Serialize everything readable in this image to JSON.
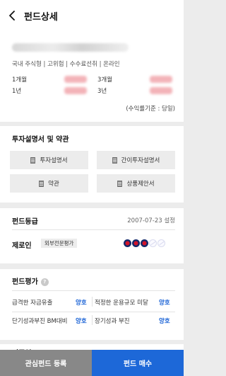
{
  "header": {
    "title": "펀드상세"
  },
  "summary": {
    "tags": "국내 주식형 | 고위험 | 수수료선취 | 온라인",
    "perf": [
      {
        "label": "1개월"
      },
      {
        "label": "3개월"
      },
      {
        "label": "1년"
      },
      {
        "label": "3년"
      }
    ],
    "basis": "(수익률기준 : 당일)"
  },
  "docs": {
    "title": "투자설명서 및 약관",
    "buttons": [
      "투자설명서",
      "간이투자설명서",
      "약관",
      "상품제안서"
    ]
  },
  "grade": {
    "title": "펀드등급",
    "date": "2007-07-23 설정",
    "agency": "제로인",
    "agency_badge": "외부전문평가",
    "level": 3,
    "max": 5
  },
  "evaluation": {
    "title": "펀드평가",
    "help": "?",
    "items": [
      {
        "label": "급격한 자금유출",
        "value": "양호"
      },
      {
        "label": "적정한 운용규모 미달",
        "value": "양호"
      },
      {
        "label": "단기성과부진 BM대비",
        "value": "양호"
      },
      {
        "label": "장기성과 부진",
        "value": "양호"
      }
    ]
  },
  "next_section": {
    "title": "기준일"
  },
  "actions": {
    "watch_label": "관심펀드 등록",
    "buy_label": "펀드 매수"
  },
  "colors": {
    "accent": "#1d68d8",
    "good": "#1b63d6",
    "gray_button": "#888888",
    "bg": "#ececec"
  }
}
